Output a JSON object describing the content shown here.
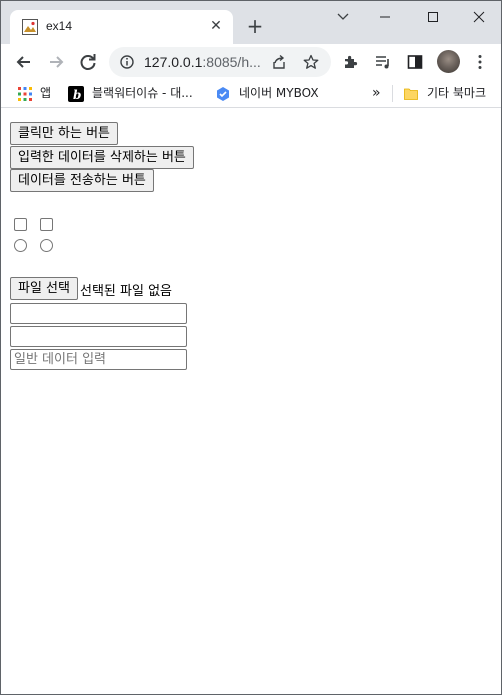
{
  "tab": {
    "title": "ex14",
    "favicon": "page-icon"
  },
  "toolbar": {
    "url_host": "127.0.0.1",
    "url_rest": ":8085/h...",
    "icons": [
      "back-icon",
      "forward-icon",
      "reload-icon",
      "info-icon",
      "share-icon",
      "star-icon",
      "extensions-icon",
      "media-queue-icon",
      "side-panel-icon",
      "profile-avatar",
      "menu-icon"
    ]
  },
  "bookmarks": {
    "apps": "앱",
    "item1": "블랙워터이슈 - 대...",
    "item2": "네이버 MYBOX",
    "more": "»",
    "other": "기타 북마크"
  },
  "page": {
    "button_click": "클릭만 하는 버튼",
    "button_reset": "입력한 데이터를 삭제하는 버튼",
    "button_submit": "데이터를 전송하는 버튼",
    "file_button": "파일 선택",
    "file_status": "선택된 파일 없음",
    "input1_value": "",
    "input2_value": "",
    "input3_placeholder": "일반 데이터 입력"
  },
  "colors": {
    "tabstrip": "#dee1e6",
    "omnibox": "#f1f3f4",
    "button_bg": "#efefef",
    "border": "#767676"
  }
}
